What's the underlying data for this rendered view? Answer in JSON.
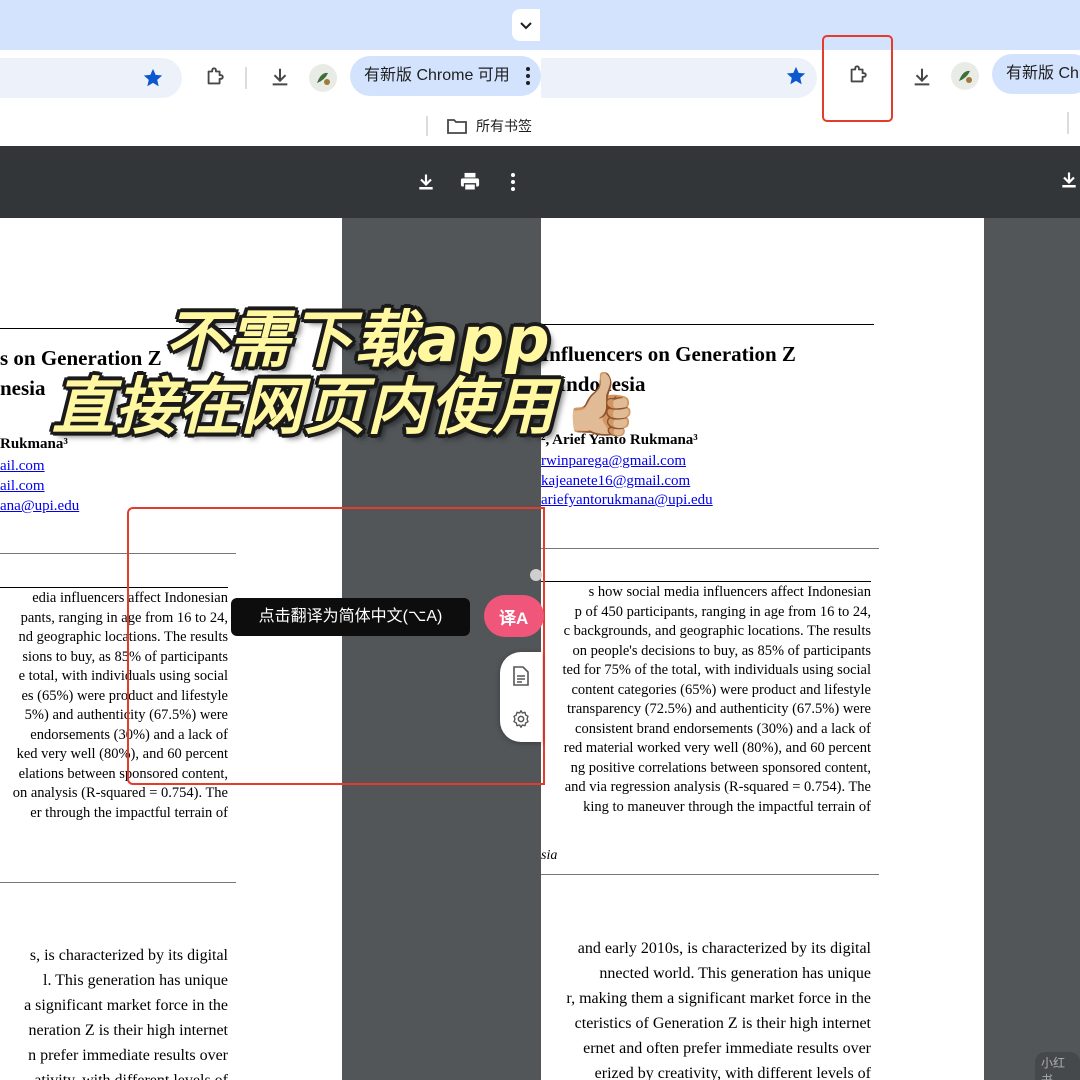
{
  "browser": {
    "update_button_left": "有新版 Chrome 可用",
    "update_button_right": "有新版 Chr",
    "bookmarks_label": "所有书签"
  },
  "overlay": {
    "caption_line1": "不需下载app",
    "caption_line2": "直接在网页内使用",
    "thumbs_emoji": "👍🏼",
    "tooltip": "点击翻译为简体中文(⌥A)",
    "translate_icon": "译A",
    "watermark": "小红书"
  },
  "left_doc": {
    "title_line1": "s on Generation Z",
    "title_line2": "nesia",
    "authors": "Rukmana³",
    "emails": [
      "ail.com",
      "ail.com",
      "ana@upi.edu"
    ],
    "abstract": [
      "edia  influencers  affect  Indonesian",
      "pants, ranging in age from 16 to 24,",
      "nd geographic locations. The results",
      "sions to buy, as 85% of participants",
      "e total, with individuals using social",
      "es (65%) were product and lifestyle",
      "5%)  and  authenticity  (67.5%)  were",
      "endorsements (30%) and a lack of",
      "ked very well (80%), and 60 percent",
      "elations between sponsored content,",
      "on analysis (R-squared = 0.754). The",
      "er through the impactful terrain of"
    ],
    "body": [
      "s, is characterized by its digital",
      "l.  This  generation  has  unique",
      " a significant market force in the",
      "neration Z is their high internet",
      "n prefer immediate results over",
      "ativity, with different levels of"
    ]
  },
  "right_doc": {
    "title_line1": "Influencers on Generation Z",
    "title_line2": "n Indonesia",
    "authors": "², Arief Yanto Rukmana³",
    "emails": [
      "rwinparega@gmail.com",
      "kajeanete16@gmail.com",
      "ariefyantorukmana@upi.edu"
    ],
    "abstract": [
      "s  how  social  media  influencers  affect  Indonesian",
      "p of 450 participants, ranging in age from 16 to 24,",
      "c backgrounds, and geographic locations. The results",
      "on people's decisions to buy, as 85% of participants",
      "ted for 75% of the total, with individuals using social",
      "content categories (65%) were product and lifestyle",
      "transparency (72.5%) and authenticity (67.5%) were",
      "consistent brand endorsements (30%) and a lack of",
      "red material worked very well (80%), and 60 percent",
      "ng positive correlations between sponsored content,",
      "and via regression analysis (R-squared = 0.754). The",
      "king to maneuver through the impactful terrain of"
    ],
    "keyword_tail": "sia",
    "body": [
      "and early 2010s, is characterized by its digital",
      "nnected  world.  This  generation  has  unique",
      "r, making them a significant market force in the",
      "cteristics of Generation Z is their high internet",
      "ernet and often prefer immediate results over",
      "erized  by  creativity,  with  different  levels  of"
    ]
  },
  "colors": {
    "accent_star": "#0b57d0",
    "red_box": "#e43b2c",
    "translate_pink": "#f0567a",
    "caption_yellow": "#fff8a0"
  }
}
